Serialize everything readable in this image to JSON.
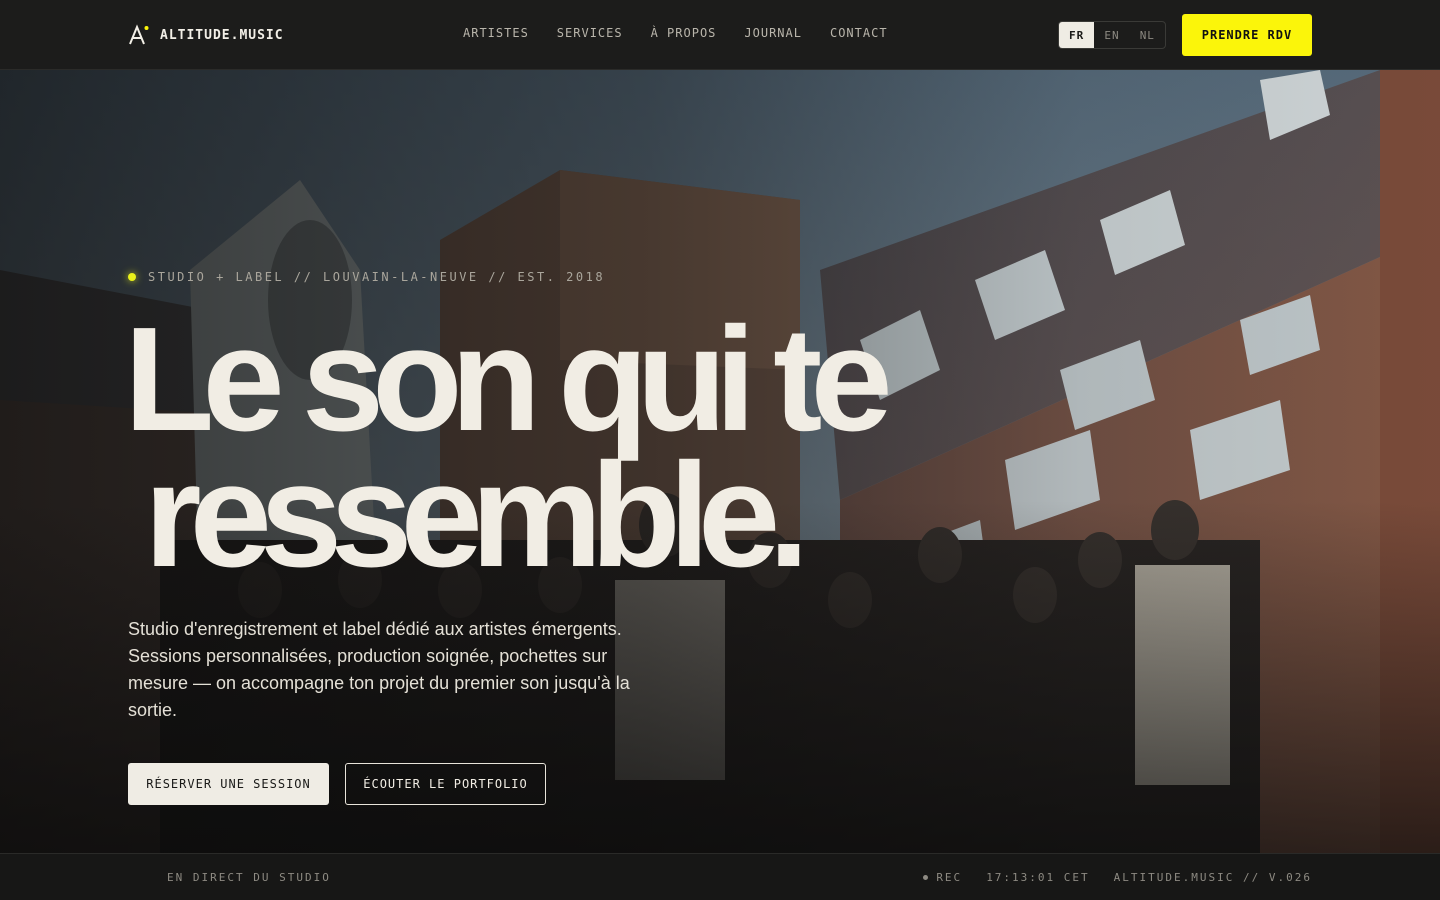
{
  "brand": {
    "name": "ALTITUDE.MUSIC",
    "accent": "#fbf50a"
  },
  "nav": {
    "items": [
      {
        "label": "ARTISTES"
      },
      {
        "label": "SERVICES"
      },
      {
        "label": "À PROPOS"
      },
      {
        "label": "JOURNAL"
      },
      {
        "label": "CONTACT"
      }
    ]
  },
  "language": {
    "options": [
      "FR",
      "EN",
      "NL"
    ],
    "selected": "FR"
  },
  "header_cta": {
    "label": "PRENDRE RDV"
  },
  "hero": {
    "eyebrow": "STUDIO + LABEL // LOUVAIN-LA-NEUVE // EST. 2018",
    "headline_line1": "Le son qui te",
    "headline_line2": "ressemble.",
    "lede": "Studio d'enregistrement et label dédié aux artistes émergents. Sessions personnalisées, production soignée, pochettes sur mesure — on accompagne ton projet du premier son jusqu'à la sortie.",
    "primary_button": "RÉSERVER UNE SESSION",
    "secondary_button": "ÉCOUTER LE PORTFOLIO"
  },
  "status_strip": {
    "left": "EN DIRECT DU STUDIO",
    "rec": "REC",
    "time": "17:13:01 CET",
    "version": "ALTITUDE.MUSIC // V.026"
  },
  "icons": {
    "logo": "altitude-a-icon",
    "rec": "rec-dot-icon",
    "live": "live-dot-icon"
  }
}
